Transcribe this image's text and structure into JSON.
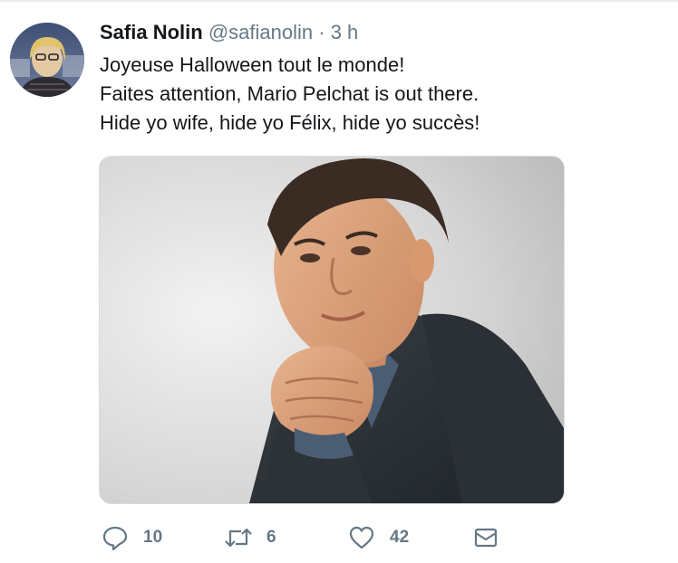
{
  "tweet": {
    "author_name": "Safia Nolin",
    "author_handle": "@safianolin",
    "separator": "·",
    "timestamp": "3 h",
    "text_lines": [
      "Joyeuse Halloween tout le monde!",
      "Faites attention, Mario Pelchat is out there.",
      "Hide yo wife, hide yo Félix, hide yo succès!"
    ]
  },
  "actions": {
    "reply_icon": "reply-icon",
    "reply_count": "10",
    "retweet_icon": "retweet-icon",
    "retweet_count": "6",
    "like_icon": "heart-icon",
    "like_count": "42",
    "message_icon": "envelope-icon"
  },
  "colors": {
    "text": "#14171a",
    "secondary": "#657786",
    "divider": "#e6ecf0",
    "icon": "#657786"
  }
}
